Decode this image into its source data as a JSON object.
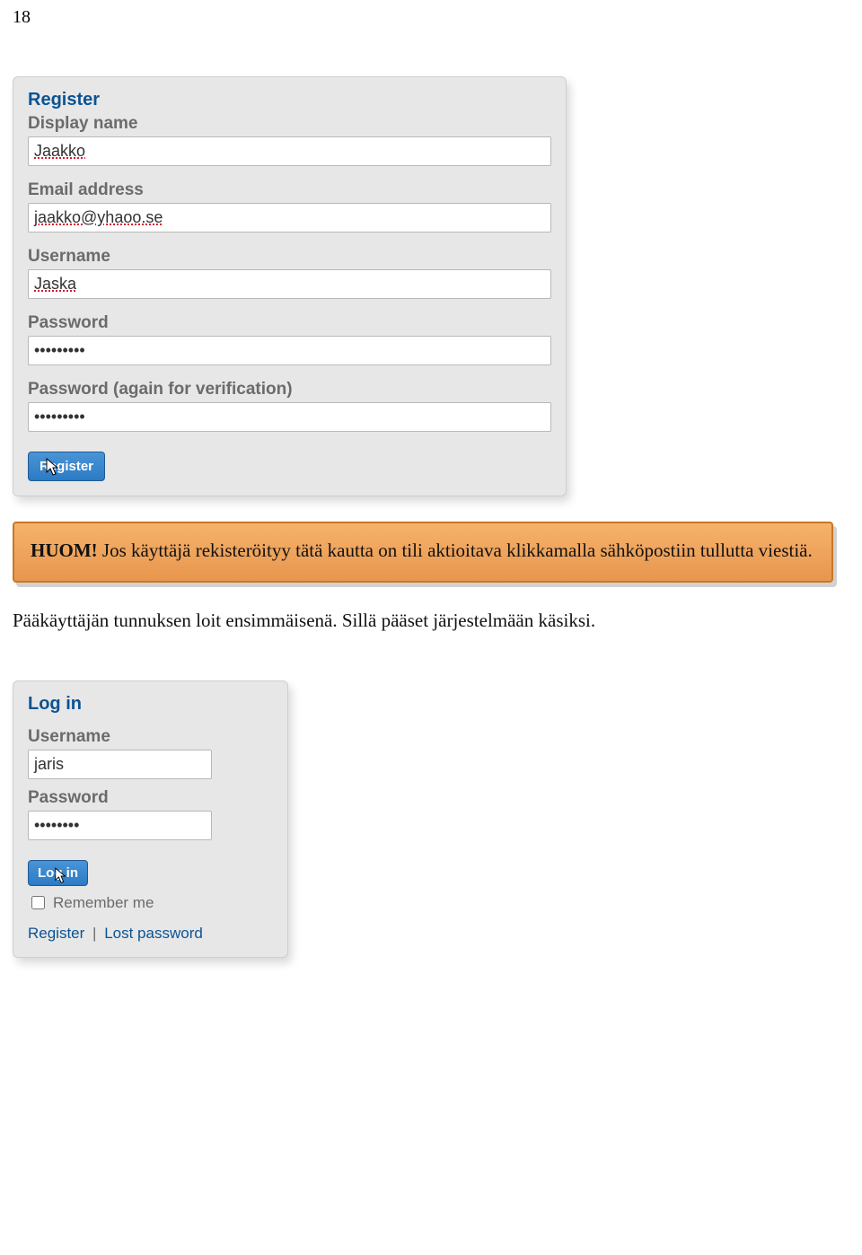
{
  "page_number": "18",
  "register_panel": {
    "title": "Register",
    "display_name_label": "Display name",
    "display_name_value": "Jaakko",
    "email_label": "Email address",
    "email_value": "jaakko@yhaoo.se",
    "username_label": "Username",
    "username_value": "Jaska",
    "password_label": "Password",
    "password_value": "•••••••••",
    "password2_label": "Password (again for verification)",
    "password2_value": "•••••••••",
    "button_label": "Register"
  },
  "note": {
    "lead": "HUOM!",
    "body": " Jos käyttäjä rekisteröityy tätä kautta on tili aktioitava klikkamalla sähköpostiin tullutta viestiä."
  },
  "mid_paragraph": "Pääkäyttäjän tunnuksen loit ensimmäisenä. Sillä pääset järjestelmään käsiksi.",
  "login_panel": {
    "title": "Log in",
    "username_label": "Username",
    "username_value": "jaris",
    "password_label": "Password",
    "password_value": "••••••••",
    "button_label": "Log in",
    "remember_label": "Remember me",
    "link_register": "Register",
    "link_lost": "Lost password",
    "sep": "|"
  }
}
